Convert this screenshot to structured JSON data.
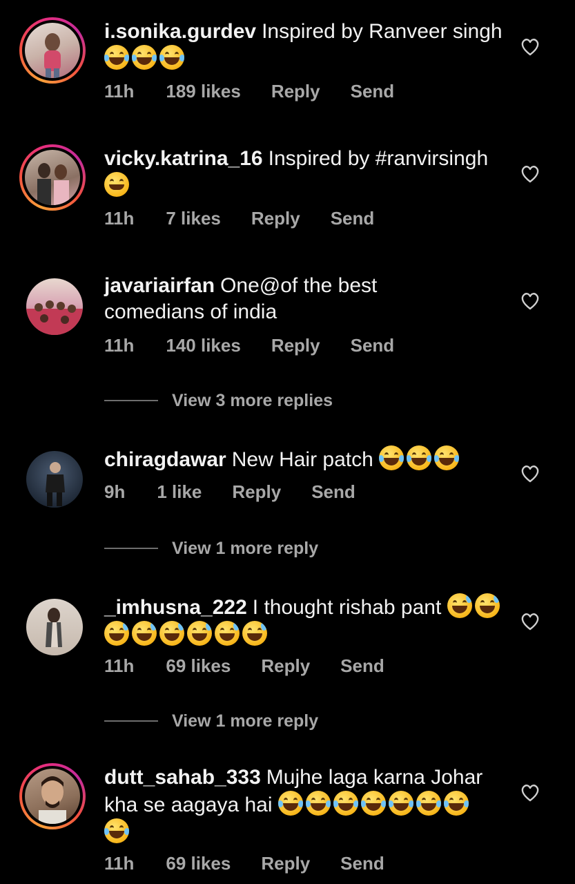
{
  "comments": [
    {
      "username": "i.sonika.gurdev",
      "text": "Inspired by Ranveer singh",
      "emojis": [
        "cry",
        "cry",
        "cry"
      ],
      "time": "11h",
      "likes": "189 likes",
      "reply": "Reply",
      "send": "Send",
      "story_ring": true,
      "avatar_color": "#c9b2a8"
    },
    {
      "username": "vicky.katrina_16",
      "text": "Inspired by #ranvirsingh",
      "emojis": [
        "smile"
      ],
      "time": "11h",
      "likes": "7 likes",
      "reply": "Reply",
      "send": "Send",
      "story_ring": true,
      "avatar_color": "#8a7063"
    },
    {
      "username": "javariairfan",
      "text": "One@of the best comedians  of india",
      "emojis": [],
      "time": "11h",
      "likes": "140 likes",
      "reply": "Reply",
      "send": "Send",
      "story_ring": false,
      "avatar_color": "#b34a5d"
    },
    {
      "username": "chiragdawar",
      "text": "New Hair patch",
      "emojis": [
        "cry",
        "cry",
        "cry"
      ],
      "time": "9h",
      "likes": "1 like",
      "reply": "Reply",
      "send": "Send",
      "story_ring": false,
      "avatar_color": "#2b3645"
    },
    {
      "username": "_imhusna_222",
      "text": "I thought rishab pant",
      "emojis": [
        "tear",
        "tear",
        "tear",
        "tear",
        "tear",
        "tear",
        "tear",
        "tear"
      ],
      "time": "11h",
      "likes": "69 likes",
      "reply": "Reply",
      "send": "Send",
      "story_ring": false,
      "avatar_color": "#c6b9ad"
    },
    {
      "username": "dutt_sahab_333",
      "text": "Mujhe laga karna Johar kha se aagaya hai",
      "emojis": [
        "cry",
        "cry",
        "cry",
        "cry",
        "cry",
        "cry",
        "cry",
        "cry"
      ],
      "time": "11h",
      "likes": "69 likes",
      "reply": "Reply",
      "send": "Send",
      "story_ring": true,
      "avatar_color": "#8c6f5a"
    }
  ],
  "view_replies": [
    "View 3 more replies",
    "View 1 more reply",
    "View 1 more reply"
  ],
  "icons": {
    "like": "heart-outline-icon"
  },
  "colors": {
    "background": "#000000",
    "text": "#f2f2f2",
    "meta": "#a8a8a8"
  }
}
